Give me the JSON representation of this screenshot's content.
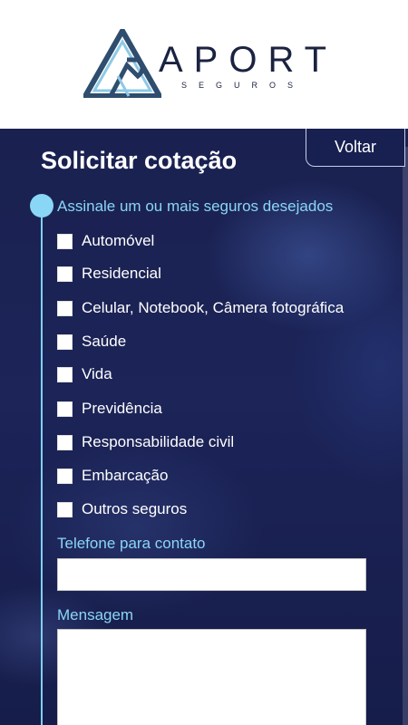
{
  "brand": {
    "name": "APORT",
    "tagline": "SEGUROS",
    "colors": {
      "mark_dark": "#2f4d6e",
      "mark_light": "#8ec9e6",
      "text": "#1b2341"
    }
  },
  "form": {
    "title": "Solicitar cotação",
    "back_label": "Voltar",
    "insurance_prompt": "Assinale um ou mais seguros desejados",
    "options": [
      {
        "label": "Automóvel",
        "checked": false
      },
      {
        "label": "Residencial",
        "checked": false
      },
      {
        "label": "Celular, Notebook, Câmera fotográfica",
        "checked": false
      },
      {
        "label": "Saúde",
        "checked": false
      },
      {
        "label": "Vida",
        "checked": false
      },
      {
        "label": "Previdência",
        "checked": false
      },
      {
        "label": "Responsabilidade civil",
        "checked": false
      },
      {
        "label": "Embarcação",
        "checked": false
      },
      {
        "label": "Outros seguros",
        "checked": false
      }
    ],
    "phone_label": "Telefone para contato",
    "phone_value": "",
    "message_label": "Mensagem",
    "message_value": ""
  },
  "colors": {
    "accent": "#8ad6f6",
    "panel": "#1c2458"
  }
}
